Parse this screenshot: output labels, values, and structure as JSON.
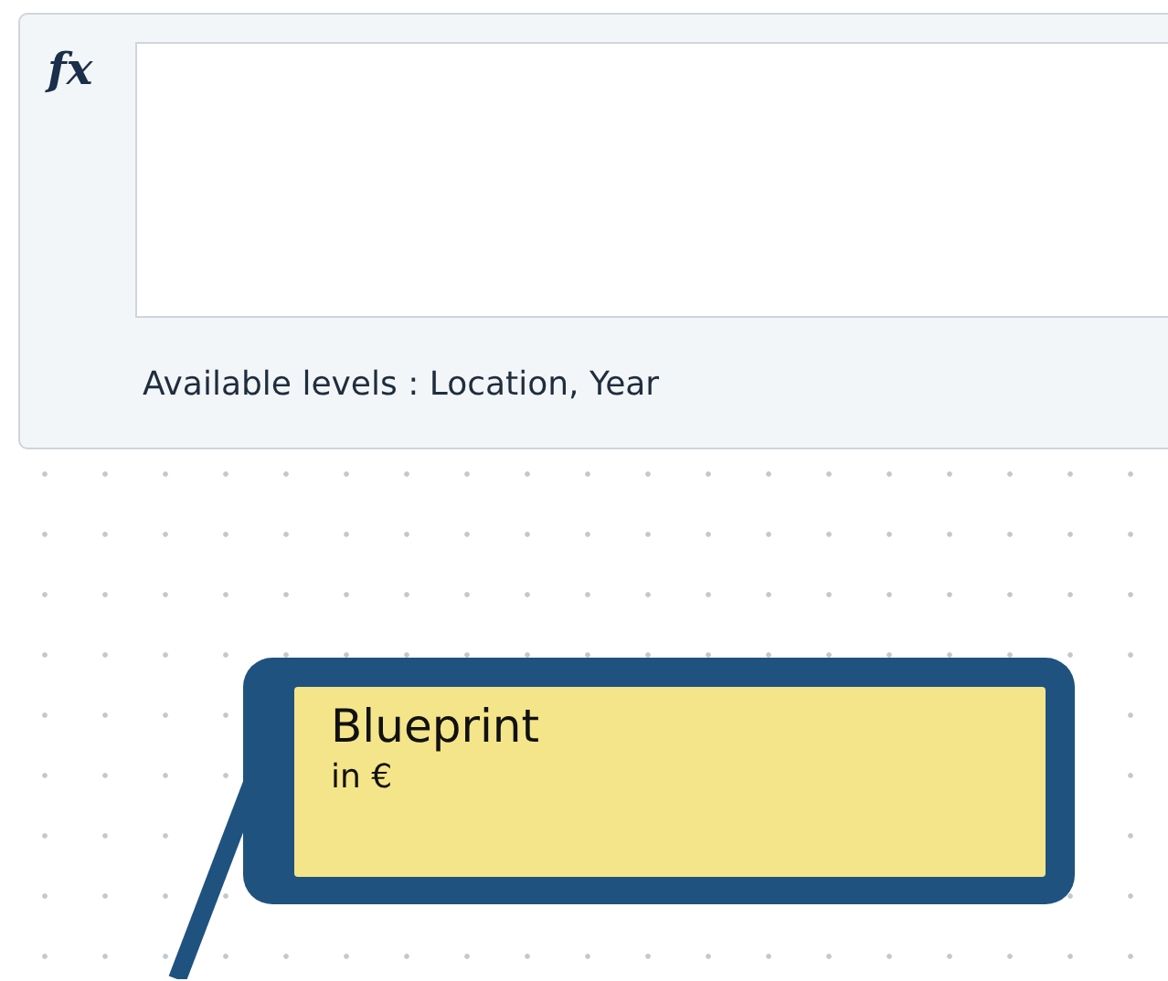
{
  "formula_panel": {
    "label": "fx",
    "available_levels": "Available levels : Location, Year"
  },
  "node": {
    "title": "Blueprint",
    "unit": "in €"
  }
}
